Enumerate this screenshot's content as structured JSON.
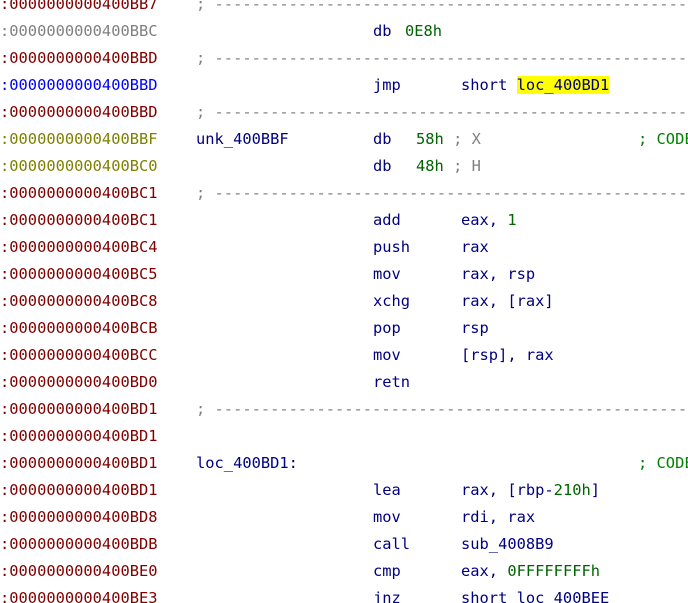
{
  "colors": {
    "address_code": "#800000",
    "address_data": "#808080",
    "address_current": "#0000ff",
    "address_unk": "#808000",
    "instruction": "#000080",
    "number": "#006400",
    "comment": "#808080",
    "highlight": "#ffff00"
  },
  "rows": [
    {
      "addr": ":0000000000400BB7",
      "addr_color": "#800000",
      "kind": "sep",
      "sep": "; ---------------------------------------------------------------------------"
    },
    {
      "addr": ":0000000000400BBC",
      "addr_color": "#808080",
      "kind": "db1",
      "mnemonic": "db",
      "value": "0E8h"
    },
    {
      "addr": ":0000000000400BBD",
      "addr_color": "#800000",
      "kind": "sep",
      "sep": "; ---------------------------------------------------------------------------"
    },
    {
      "addr": ":0000000000400BBD",
      "addr_color": "#0000ff",
      "kind": "jmp",
      "mnemonic": "jmp",
      "operand_prefix": "short ",
      "operand_target": "loc_400BD1"
    },
    {
      "addr": ":0000000000400BBD",
      "addr_color": "#800000",
      "kind": "sep",
      "sep": "; ---------------------------------------------------------------------------"
    },
    {
      "addr": ":0000000000400BBF",
      "addr_color": "#808000",
      "kind": "db2",
      "label": "unk_400BBF",
      "mnemonic": "db",
      "value": "58h",
      "comment": " ; X",
      "right_comment": "; CODE XREF"
    },
    {
      "addr": ":0000000000400BC0",
      "addr_color": "#808000",
      "kind": "db2",
      "mnemonic": "db",
      "value": "48h",
      "comment": " ; H"
    },
    {
      "addr": ":0000000000400BC1",
      "addr_color": "#800000",
      "kind": "sep",
      "sep": "; ---------------------------------------------------------------------------"
    },
    {
      "addr": ":0000000000400BC1",
      "addr_color": "#800000",
      "kind": "ins",
      "mnemonic": "add",
      "operand": "eax, ",
      "operand_num": "1"
    },
    {
      "addr": ":0000000000400BC4",
      "addr_color": "#800000",
      "kind": "ins",
      "mnemonic": "push",
      "operand": "rax"
    },
    {
      "addr": ":0000000000400BC5",
      "addr_color": "#800000",
      "kind": "ins",
      "mnemonic": "mov",
      "operand": "rax, rsp"
    },
    {
      "addr": ":0000000000400BC8",
      "addr_color": "#800000",
      "kind": "ins",
      "mnemonic": "xchg",
      "operand": "rax, [rax]"
    },
    {
      "addr": ":0000000000400BCB",
      "addr_color": "#800000",
      "kind": "ins",
      "mnemonic": "pop",
      "operand": "rsp"
    },
    {
      "addr": ":0000000000400BCC",
      "addr_color": "#800000",
      "kind": "ins",
      "mnemonic": "mov",
      "operand": "[rsp], rax"
    },
    {
      "addr": ":0000000000400BD0",
      "addr_color": "#800000",
      "kind": "ins",
      "mnemonic": "retn",
      "operand": ""
    },
    {
      "addr": ":0000000000400BD1",
      "addr_color": "#800000",
      "kind": "sep",
      "sep": "; ---------------------------------------------------------------------------"
    },
    {
      "addr": ":0000000000400BD1",
      "addr_color": "#800000",
      "kind": "blank"
    },
    {
      "addr": ":0000000000400BD1",
      "addr_color": "#800000",
      "kind": "label",
      "label": "loc_400BD1",
      "label_suffix": ":",
      "right_comment": "; CODE XREF"
    },
    {
      "addr": ":0000000000400BD1",
      "addr_color": "#800000",
      "kind": "ins",
      "mnemonic": "lea",
      "operand": "rax, [rbp-",
      "operand_num": "210h",
      "operand_suffix": "]"
    },
    {
      "addr": ":0000000000400BD8",
      "addr_color": "#800000",
      "kind": "ins",
      "mnemonic": "mov",
      "operand": "rdi, rax"
    },
    {
      "addr": ":0000000000400BDB",
      "addr_color": "#800000",
      "kind": "ins",
      "mnemonic": "call",
      "operand": "sub_4008B9"
    },
    {
      "addr": ":0000000000400BE0",
      "addr_color": "#800000",
      "kind": "ins",
      "mnemonic": "cmp",
      "operand": "eax, ",
      "operand_num": "0FFFFFFFFh"
    },
    {
      "addr": ":0000000000400BE3",
      "addr_color": "#800000",
      "kind": "ins",
      "mnemonic": "jnz",
      "operand": "short loc_400BEE"
    }
  ]
}
